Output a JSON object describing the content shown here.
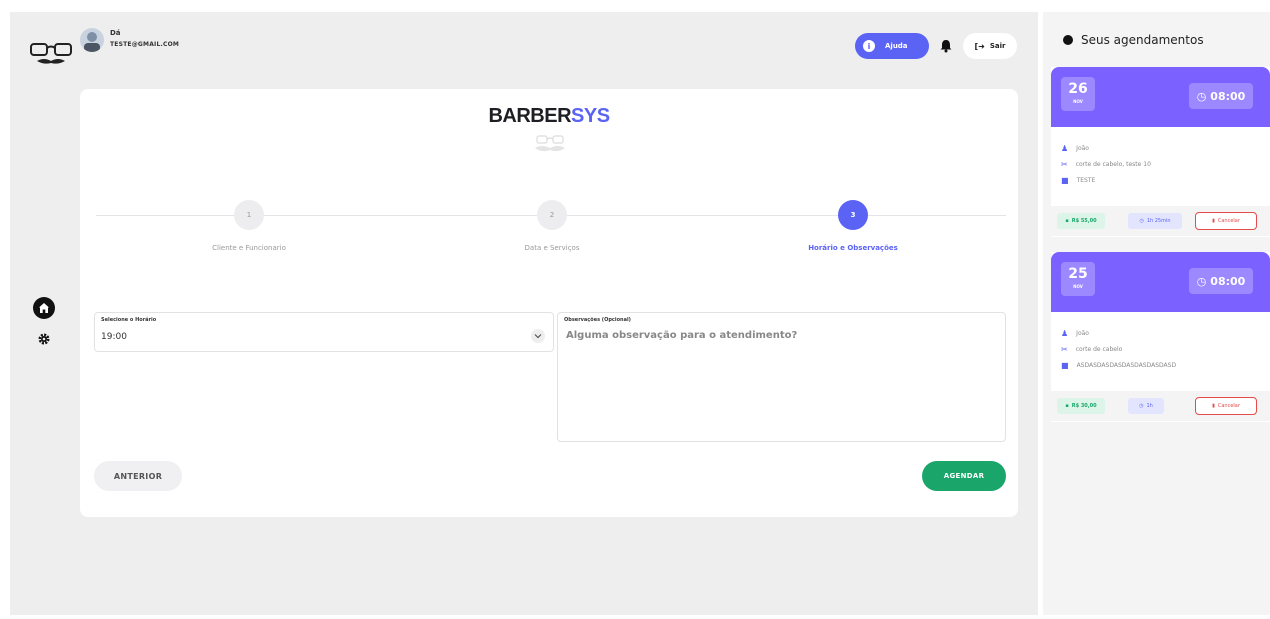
{
  "user": {
    "name": "Dá",
    "email": "TESTE@GMAIL.COM"
  },
  "header": {
    "help_label": "Ajuda",
    "help_icon": "info-icon",
    "notification_icon": "bell-icon",
    "exit_label": "Sair",
    "exit_icon": "sign-out-icon"
  },
  "sidebar": {
    "items": [
      {
        "icon": "home-icon"
      },
      {
        "icon": "gear-icon"
      }
    ]
  },
  "brand": {
    "part1": "BARBER",
    "part2": "SYS"
  },
  "steps": [
    {
      "number": "1",
      "label": "Cliente e Funcionario",
      "active": false
    },
    {
      "number": "2",
      "label": "Data e Serviços",
      "active": false
    },
    {
      "number": "3",
      "label": "Horário e Observações",
      "active": true
    }
  ],
  "form": {
    "time_label": "Selecione o Horário",
    "time_value": "19:00",
    "notes_label": "Observações (Opcional)",
    "notes_placeholder": "Alguma observação para o atendimento?"
  },
  "buttons": {
    "previous": "ANTERIOR",
    "schedule": "AGENDAR"
  },
  "appointments_panel": {
    "title": "Seus agendamentos",
    "appointments": [
      {
        "day": "26",
        "month": "NOV",
        "time": "08:00",
        "client": "João",
        "services": "corte de cabelo, teste 10",
        "notes": "TESTE",
        "price": "R$ 55,00",
        "duration": "1h 25min",
        "cancel_label": "Cancelar"
      },
      {
        "day": "25",
        "month": "NOV",
        "time": "08:00",
        "client": "João",
        "services": "corte de cabelo",
        "notes": "ASDASDASDASDASDASDASDASD",
        "price": "R$ 30,00",
        "duration": "1h",
        "cancel_label": "Cancelar"
      }
    ]
  },
  "colors": {
    "accent": "#5b63f5",
    "appointment_header": "#7b61ff",
    "success": "#1aa66a",
    "danger": "#e84a4a",
    "background": "#eeeeef"
  }
}
